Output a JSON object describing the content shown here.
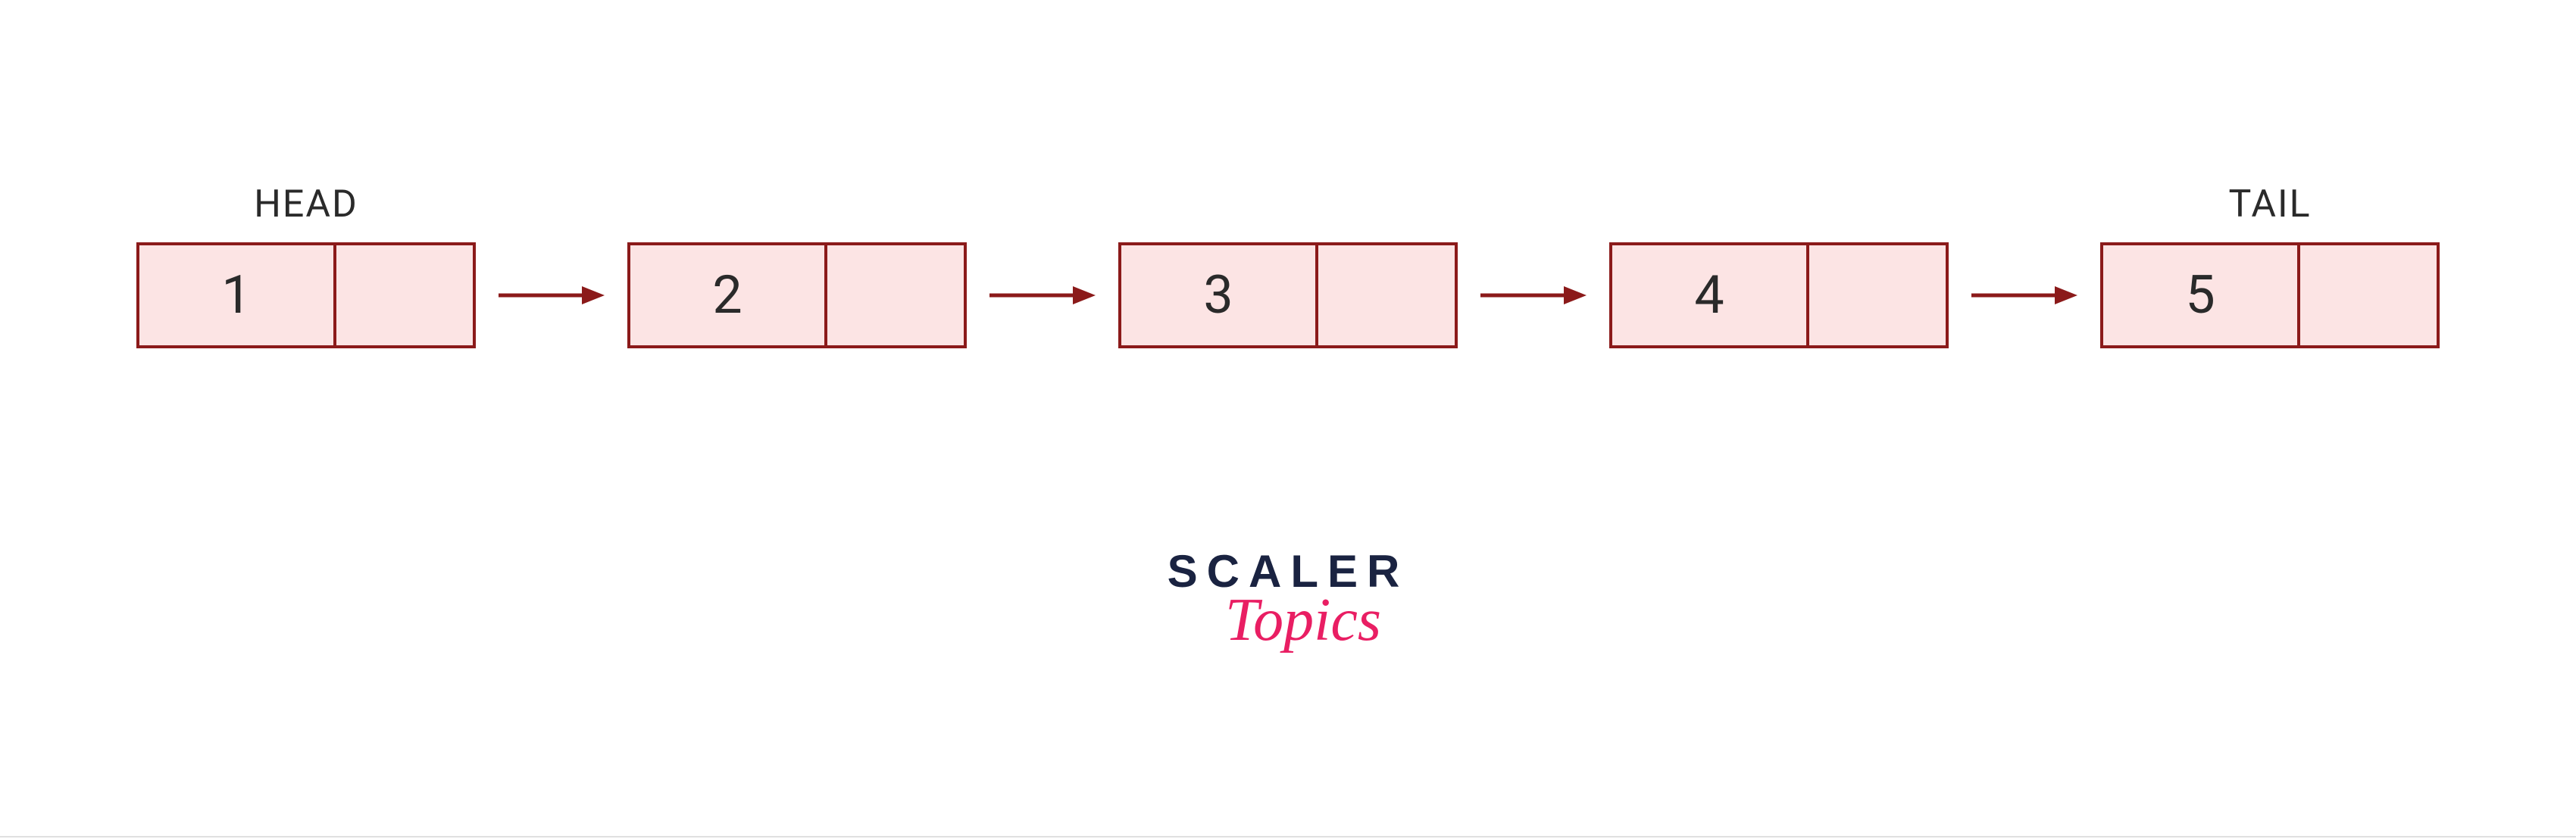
{
  "linkedList": {
    "headLabel": "HEAD",
    "tailLabel": "TAIL",
    "nodes": [
      {
        "value": "1",
        "label": "HEAD"
      },
      {
        "value": "2",
        "label": ""
      },
      {
        "value": "3",
        "label": ""
      },
      {
        "value": "4",
        "label": ""
      },
      {
        "value": "5",
        "label": "TAIL"
      }
    ]
  },
  "logo": {
    "line1": "SCALER",
    "line2": "Topics"
  },
  "colors": {
    "nodeBorder": "#8b1a1a",
    "nodeFill": "#fce4e4",
    "arrowColor": "#8b1a1a",
    "textColor": "#2a2a2a",
    "logoScaler": "#1a2341",
    "logoTopics": "#e91e63"
  }
}
